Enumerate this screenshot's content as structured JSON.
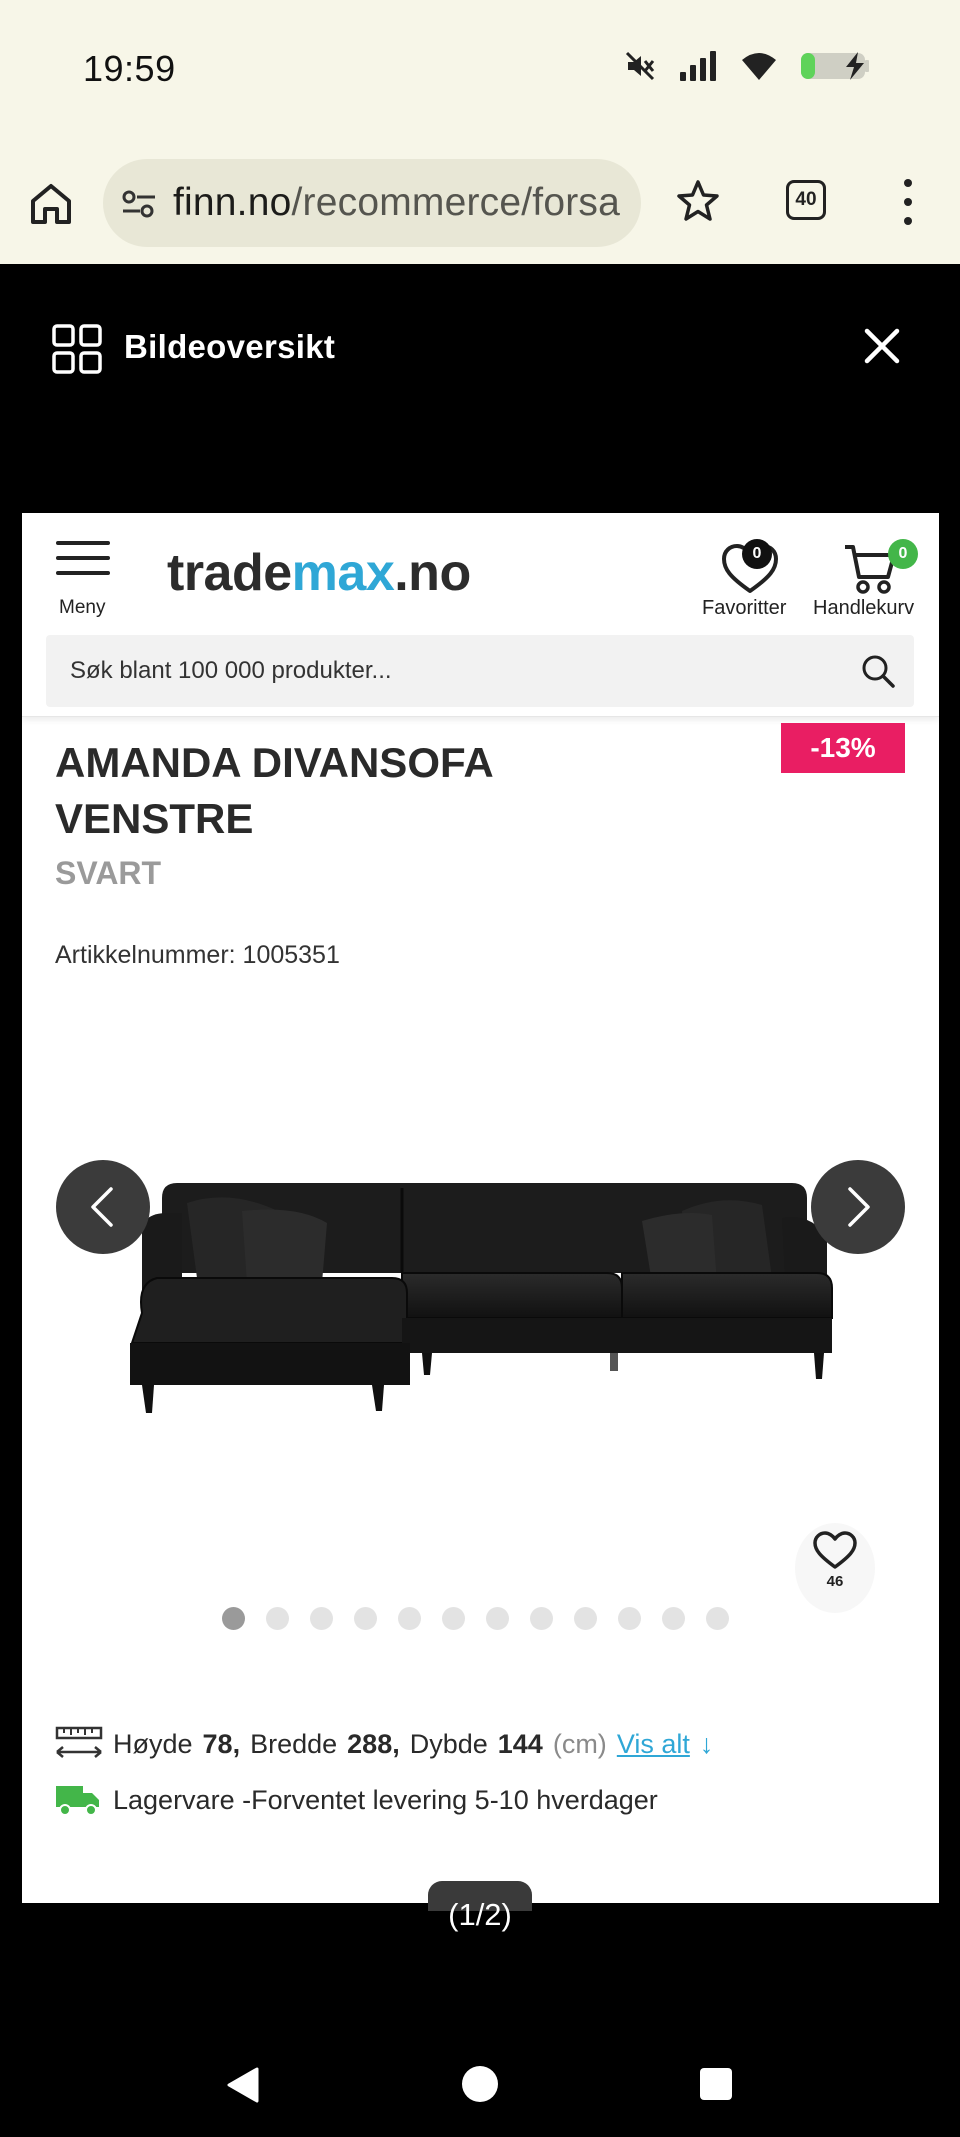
{
  "status_bar": {
    "time": "19:59"
  },
  "browser": {
    "url_domain": "finn.no",
    "url_path": "/recommerce/forsa",
    "tab_count": "40"
  },
  "gallery": {
    "title": "Bildeoversikt",
    "page_counter": "(1/2)"
  },
  "site": {
    "menu_label": "Meny",
    "logo_trade": "trade",
    "logo_max": "max",
    "logo_tld": ".no",
    "favorites_label": "Favoritter",
    "favorites_count": "0",
    "cart_label": "Handlekurv",
    "cart_count": "0",
    "search_placeholder": "Søk blant 100 000 produkter..."
  },
  "product": {
    "discount": "-13%",
    "title_line1": "AMANDA DIVANSOFA",
    "title_line2": "VENSTRE",
    "color": "SVART",
    "article_label": "Artikkelnummer: 1005351",
    "favorite_count": "46",
    "image_count": 12,
    "active_image": 0,
    "dims": {
      "height_label": "Høyde",
      "height": "78,",
      "width_label": "Bredde",
      "width": "288,",
      "depth_label": "Dybde",
      "depth": "144",
      "unit": "(cm)",
      "vis_alt": "Vis alt",
      "arrow": "↓"
    },
    "delivery": "Lagervare -Forventet levering 5-10 hverdager"
  },
  "icons": {
    "home": "home-icon",
    "tune": "site-info-icon",
    "star": "bookmark-star-icon",
    "more": "more-vert-icon",
    "grid": "grid-icon",
    "close": "close-icon",
    "heart": "heart-icon",
    "cart": "cart-icon",
    "search": "search-icon",
    "ruler": "ruler-icon",
    "truck": "truck-icon"
  },
  "colors": {
    "brand_blue": "#2fa7d6",
    "discount_pink": "#e91e63",
    "cart_badge_green": "#43b649",
    "chrome_bg": "#f7f6e8"
  }
}
